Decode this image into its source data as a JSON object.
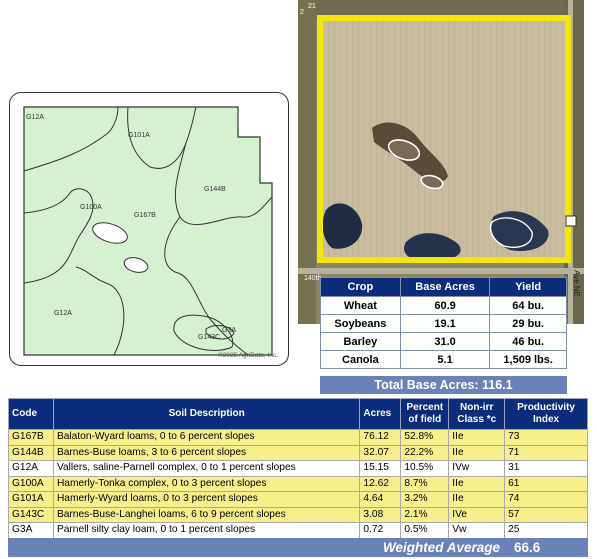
{
  "soil_map": {
    "labels": [
      "G12A",
      "G101A",
      "G144B",
      "G100A",
      "G167B",
      "G12A",
      "G3A",
      "G143C"
    ],
    "copyright": "©2025 AgriData, Inc."
  },
  "aerial": {
    "road_labels": [
      "21",
      "2",
      "140th",
      "Ave NE"
    ]
  },
  "crop_table": {
    "headers": [
      "Crop",
      "Base Acres",
      "Yield"
    ],
    "rows": [
      {
        "crop": "Wheat",
        "base_acres": "60.9",
        "yield": "64 bu."
      },
      {
        "crop": "Soybeans",
        "base_acres": "19.1",
        "yield": "29 bu."
      },
      {
        "crop": "Barley",
        "base_acres": "31.0",
        "yield": "46 bu."
      },
      {
        "crop": "Canola",
        "base_acres": "5.1",
        "yield": "1,509 lbs."
      }
    ],
    "total": "Total Base Acres: 116.1"
  },
  "soil_table": {
    "headers": [
      "Code",
      "Soil Description",
      "Acres",
      "Percent of field",
      "Non-irr Class *c",
      "Productivity Index"
    ],
    "rows": [
      {
        "code": "G167B",
        "description": "Balaton-Wyard loams, 0 to 6 percent slopes",
        "acres": "76.12",
        "percent": "52.8%",
        "class": "IIe",
        "pi": "73",
        "highlight": true
      },
      {
        "code": "G144B",
        "description": "Barnes-Buse loams, 3 to 6 percent slopes",
        "acres": "32.07",
        "percent": "22.2%",
        "class": "IIe",
        "pi": "71",
        "highlight": true
      },
      {
        "code": "G12A",
        "description": "Vallers, saline-Parnell complex, 0 to 1 percent slopes",
        "acres": "15.15",
        "percent": "10.5%",
        "class": "IVw",
        "pi": "31",
        "highlight": false
      },
      {
        "code": "G100A",
        "description": "Hamerly-Tonka complex, 0 to 3 percent slopes",
        "acres": "12.62",
        "percent": "8.7%",
        "class": "IIe",
        "pi": "61",
        "highlight": true
      },
      {
        "code": "G101A",
        "description": "Hamerly-Wyard loams, 0 to 3 percent slopes",
        "acres": "4.64",
        "percent": "3.2%",
        "class": "IIe",
        "pi": "74",
        "highlight": true
      },
      {
        "code": "G143C",
        "description": "Barnes-Buse-Langhei loams, 6 to 9 percent slopes",
        "acres": "3.08",
        "percent": "2.1%",
        "class": "IVe",
        "pi": "57",
        "highlight": true
      },
      {
        "code": "G3A",
        "description": "Parnell silty clay loam, 0 to 1 percent slopes",
        "acres": "0.72",
        "percent": "0.5%",
        "class": "Vw",
        "pi": "25",
        "highlight": false
      }
    ],
    "weighted_average_label": "Weighted Average",
    "weighted_average_value": "66.6"
  },
  "colors": {
    "header_blue": "#0a2c7a",
    "summary_blue": "#6b82b8",
    "highlight_yellow": "#f6ef8c",
    "soil_green": "#d6f1cf",
    "boundary_yellow": "#f2e60c"
  }
}
